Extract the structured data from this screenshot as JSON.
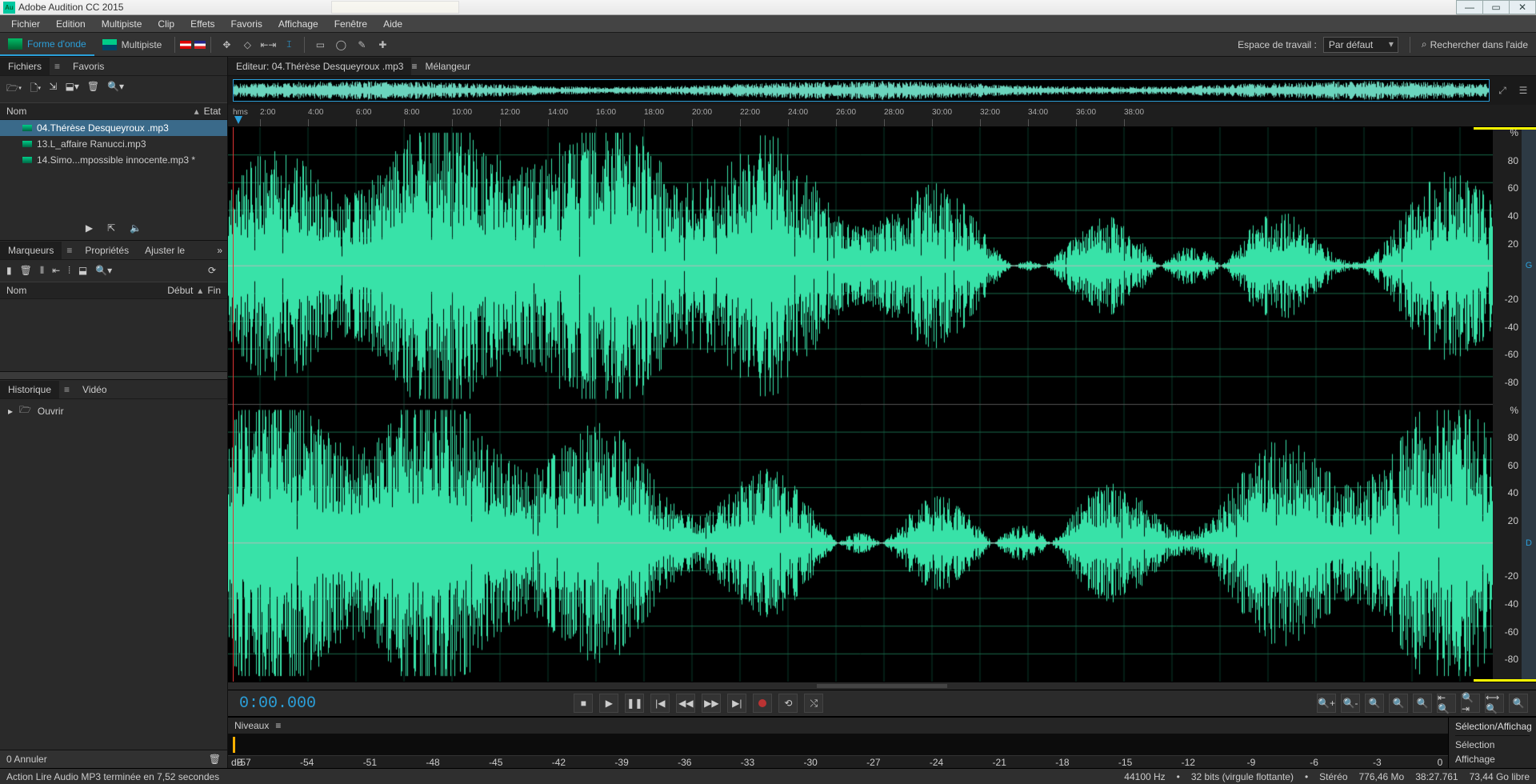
{
  "title": "Adobe Audition CC 2015",
  "menu": [
    "Fichier",
    "Edition",
    "Multipiste",
    "Clip",
    "Effets",
    "Favoris",
    "Affichage",
    "Fenêtre",
    "Aide"
  ],
  "modes": {
    "waveform": "Forme d'onde",
    "multitrack": "Multipiste"
  },
  "workspace": {
    "label": "Espace de travail :",
    "value": "Par défaut",
    "search": "Rechercher dans l'aide"
  },
  "leftPanels": {
    "filesTab": "Fichiers",
    "favTab": "Favoris",
    "cols": {
      "name": "Nom",
      "state": "Etat"
    },
    "files": [
      {
        "name": "04.Thérèse Desqueyroux .mp3",
        "sel": true
      },
      {
        "name": "13.L_affaire Ranucci.mp3",
        "sel": false
      },
      {
        "name": "14.Simo...mpossible innocente.mp3 *",
        "sel": false
      }
    ],
    "markersTab": "Marqueurs",
    "propsTab": "Propriétés",
    "fitTab": "Ajuster le",
    "mcols": {
      "name": "Nom",
      "start": "Début",
      "end": "Fin"
    },
    "histTab": "Historique",
    "videoTab": "Vidéo",
    "open": "Ouvrir",
    "undo": {
      "count": "0",
      "label": "Annuler"
    }
  },
  "editor": {
    "tab": "Editeur: 04.Thérèse Desqueyroux .mp3",
    "mixer": "Mélangeur",
    "rulerUnit": "hms",
    "ticks": [
      "2:00",
      "4:00",
      "6:00",
      "8:00",
      "10:00",
      "12:00",
      "14:00",
      "16:00",
      "18:00",
      "20:00",
      "22:00",
      "24:00",
      "26:00",
      "28:00",
      "30:00",
      "32:00",
      "34:00",
      "36:00",
      "38:00"
    ],
    "channels": {
      "left": "G",
      "right": "D"
    },
    "dbLabels": [
      "%",
      "80",
      "60",
      "40",
      "20",
      "",
      "-20",
      "-40",
      "-60",
      "-80"
    ],
    "timecode": "0:00.000"
  },
  "levels": {
    "title": "Niveaux",
    "unit": "dB",
    "ticks": [
      "-57",
      "-54",
      "-51",
      "-48",
      "-45",
      "-42",
      "-39",
      "-36",
      "-33",
      "-30",
      "-27",
      "-24",
      "-21",
      "-18",
      "-15",
      "-12",
      "-9",
      "-6",
      "-3",
      "0"
    ],
    "selTitle": "Sélection/Affichag",
    "sel": "Sélection",
    "aff": "Affichage"
  },
  "status": {
    "msg": "Action Lire Audio MP3 terminée en 7,52 secondes",
    "sr": "44100 Hz",
    "bits": "32 bits (virgule flottante)",
    "ch": "Stéréo",
    "size": "776,46 Mo",
    "dur": "38:27.761",
    "free": "73,44 Go libre"
  }
}
